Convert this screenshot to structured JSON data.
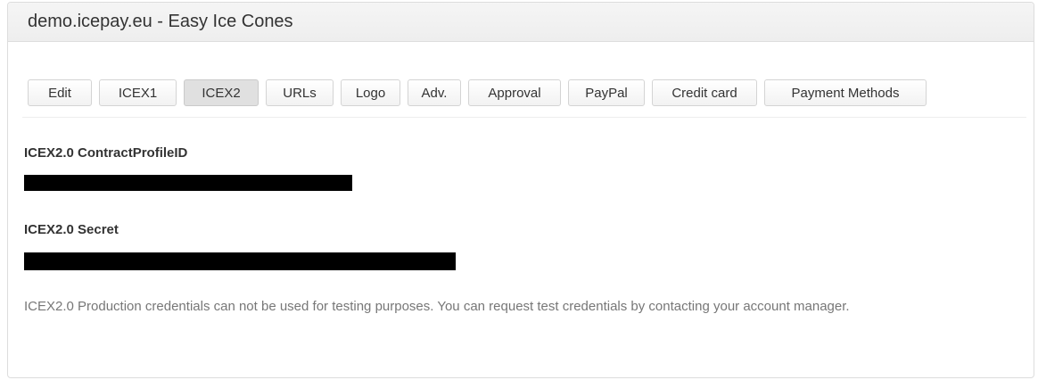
{
  "panel": {
    "title": "demo.icepay.eu - Easy Ice Cones"
  },
  "tabs": [
    {
      "label": "Edit",
      "active": false
    },
    {
      "label": "ICEX1",
      "active": false
    },
    {
      "label": "ICEX2",
      "active": true
    },
    {
      "label": "URLs",
      "active": false
    },
    {
      "label": "Logo",
      "active": false
    },
    {
      "label": "Adv.",
      "active": false
    },
    {
      "label": "Approval",
      "active": false
    },
    {
      "label": "PayPal",
      "active": false
    },
    {
      "label": "Credit card",
      "active": false
    },
    {
      "label": "Payment Methods",
      "active": false
    }
  ],
  "fields": {
    "contract_profile_id": {
      "label": "ICEX2.0 ContractProfileID",
      "value_redacted": true
    },
    "secret": {
      "label": "ICEX2.0 Secret",
      "value_redacted": true
    }
  },
  "note": "ICEX2.0 Production credentials can not be used for testing purposes. You can request test credentials by contacting your account manager.",
  "colors": {
    "heading_bg": "#eeeeee",
    "active_tab_bg": "#e0e0e0",
    "note_text": "#777777",
    "redaction": "#000000"
  }
}
